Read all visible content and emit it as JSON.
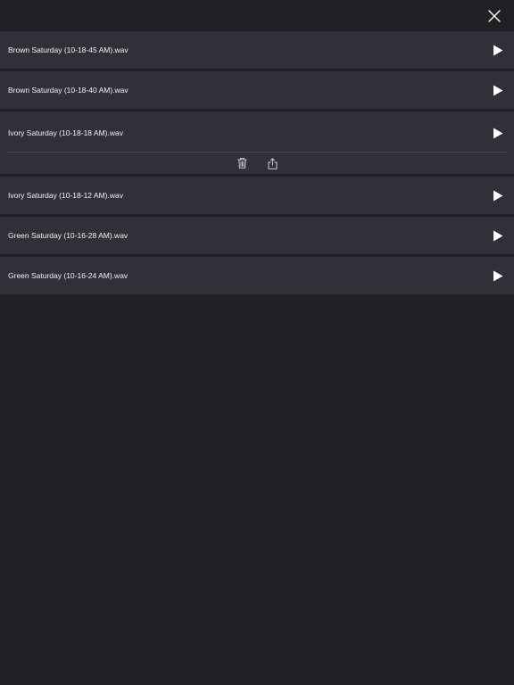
{
  "header": {
    "close_icon": "close-icon"
  },
  "recordings": [
    {
      "name": "Brown Saturday (10-18-45 AM).wav",
      "expanded": false
    },
    {
      "name": "Brown Saturday (10-18-40 AM).wav",
      "expanded": false
    },
    {
      "name": "Ivory Saturday (10-18-18 AM).wav",
      "expanded": true
    },
    {
      "name": "Ivory Saturday (10-18-12 AM).wav",
      "expanded": false
    },
    {
      "name": "Green Saturday (10-16-28 AM).wav",
      "expanded": false
    },
    {
      "name": "Green Saturday (10-16-24 AM).wav",
      "expanded": false
    }
  ],
  "actions": {
    "delete_icon": "trash-icon",
    "share_icon": "share-icon"
  },
  "colors": {
    "background": "#212025",
    "row": "#313038",
    "text": "#f2f2f4",
    "divider": "#4a4952"
  }
}
